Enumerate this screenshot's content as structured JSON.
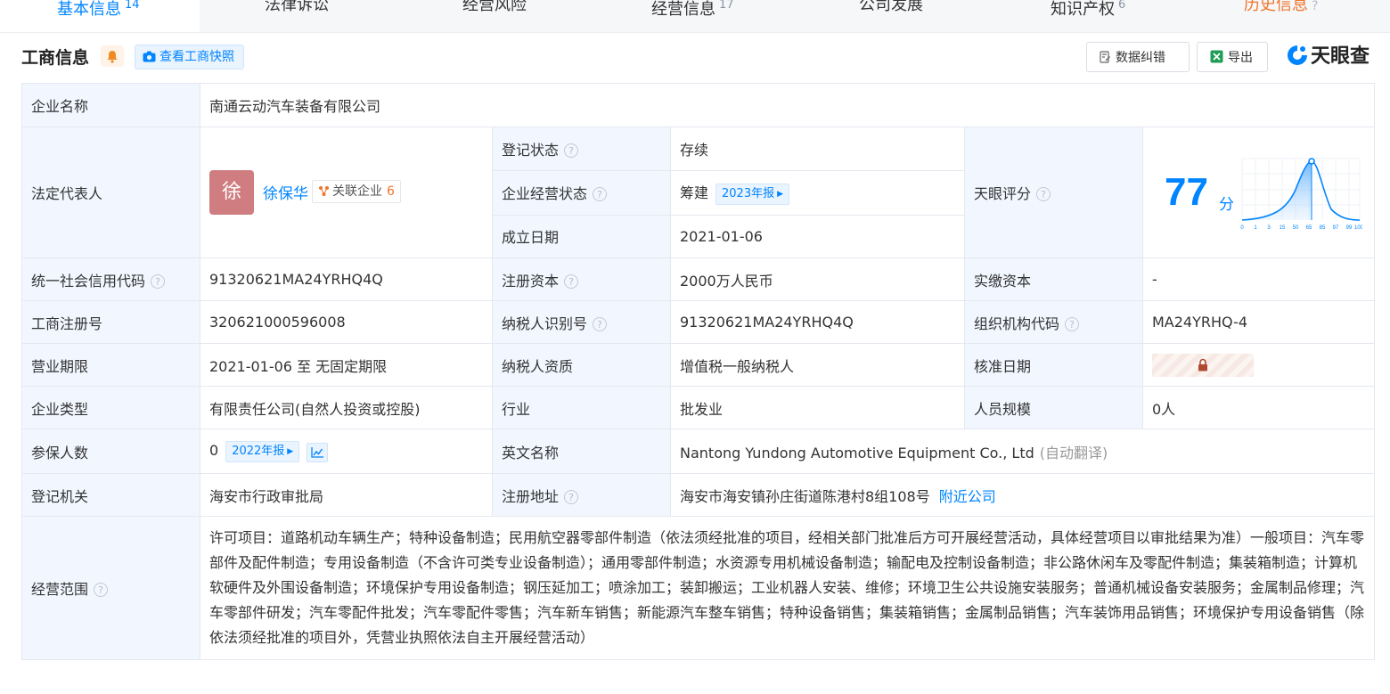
{
  "tabs": [
    {
      "label": "基本信息",
      "count": "14",
      "active": true
    },
    {
      "label": "法律诉讼",
      "count": ""
    },
    {
      "label": "经营风险",
      "count": ""
    },
    {
      "label": "经营信息",
      "count": "17"
    },
    {
      "label": "公司发展",
      "count": ""
    },
    {
      "label": "知识产权",
      "count": "6"
    },
    {
      "label": "历史信息",
      "count": ""
    }
  ],
  "header": {
    "title": "工商信息",
    "snapshot_label": "查看工商快照",
    "correction_label": "数据纠错",
    "export_label": "导出",
    "brand": "天眼查"
  },
  "company": {
    "name_label": "企业名称",
    "name": "南通云动汽车装备有限公司",
    "legal_rep_label": "法定代表人",
    "legal_rep_avatar": "徐",
    "legal_rep_name": "徐保华",
    "related_label": "关联企业",
    "related_count": "6",
    "reg_status_label": "登记状态",
    "reg_status": "存续",
    "biz_status_label": "企业经营状态",
    "biz_status": "筹建",
    "report_2023": "2023年报",
    "found_date_label": "成立日期",
    "found_date": "2021-01-06",
    "score_label": "天眼评分",
    "score": "77",
    "score_unit": "分",
    "score_axis": [
      "0",
      "1",
      "3",
      "15",
      "50",
      "65",
      "85",
      "97",
      "99",
      "100"
    ],
    "credit_code_label": "统一社会信用代码",
    "credit_code": "91320621MA24YRHQ4Q",
    "reg_capital_label": "注册资本",
    "reg_capital": "2000万人民币",
    "paid_capital_label": "实缴资本",
    "paid_capital": "-",
    "reg_no_label": "工商注册号",
    "reg_no": "320621000596008",
    "taxpayer_id_label": "纳税人识别号",
    "taxpayer_id": "91320621MA24YRHQ4Q",
    "org_code_label": "组织机构代码",
    "org_code": "MA24YRHQ-4",
    "term_label": "营业期限",
    "term": "2021-01-06 至 无固定期限",
    "tax_qual_label": "纳税人资质",
    "tax_qual": "增值税一般纳税人",
    "approval_date_label": "核准日期",
    "type_label": "企业类型",
    "type": "有限责任公司(自然人投资或控股)",
    "industry_label": "行业",
    "industry": "批发业",
    "staff_label": "人员规模",
    "staff": "0人",
    "insured_label": "参保人数",
    "insured": "0",
    "report_2022": "2022年报",
    "en_name_label": "英文名称",
    "en_name": "Nantong Yundong Automotive Equipment Co., Ltd",
    "auto_translate": "(自动翻译)",
    "authority_label": "登记机关",
    "authority": "海安市行政审批局",
    "address_label": "注册地址",
    "address": "海安市海安镇孙庄街道陈港村8组108号",
    "nearby_label": "附近公司",
    "scope_label": "经营范围",
    "scope": "许可项目：道路机动车辆生产；特种设备制造；民用航空器零部件制造（依法须经批准的项目，经相关部门批准后方可开展经营活动，具体经营项目以审批结果为准）一般项目：汽车零部件及配件制造；专用设备制造（不含许可类专业设备制造）；通用零部件制造；水资源专用机械设备制造；输配电及控制设备制造；非公路休闲车及零配件制造；集装箱制造；计算机软硬件及外围设备制造；环境保护专用设备制造；钢压延加工；喷涂加工；装卸搬运；工业机器人安装、维修；环境卫生公共设施安装服务；普通机械设备安装服务；金属制品修理；汽车零部件研发；汽车零配件批发；汽车零配件零售；汽车新车销售；新能源汽车整车销售；特种设备销售；集装箱销售；金属制品销售；汽车装饰用品销售；环境保护专用设备销售（除依法须经批准的项目外，凭营业执照依法自主开展经营活动）"
  },
  "colors": {
    "accent": "#0084ff",
    "label_bg": "#f2f7ff",
    "status_green": "#00a653",
    "history_orange": "#f0752b"
  }
}
